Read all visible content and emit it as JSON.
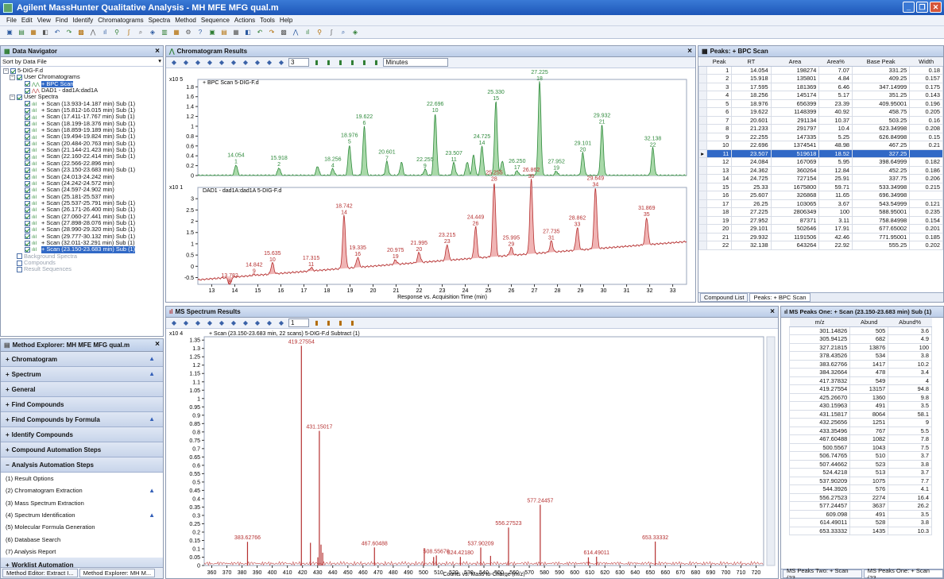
{
  "window": {
    "title": "Agilent MassHunter Qualitative Analysis - MH MFE MFG qual.m"
  },
  "menu": [
    "File",
    "Edit",
    "View",
    "Find",
    "Identify",
    "Chromatograms",
    "Spectra",
    "Method",
    "Sequence",
    "Actions",
    "Tools",
    "Help"
  ],
  "data_navigator": {
    "title": "Data Navigator",
    "sort_label": "Sort by Data File",
    "file": "5-DIG-F.d",
    "user_chromatograms": "User Chromatograms",
    "chrom_items": [
      "+ BPC Scan",
      "DAD1 - dad1A:dad1A"
    ],
    "user_spectra": "User Spectra",
    "spectra": [
      "+ Scan (13.933-14.187 min) Sub (1)",
      "+ Scan (15.812-16.015 min) Sub (1)",
      "+ Scan (17.411-17.767 min) Sub (1)",
      "+ Scan (18.199-18.376 min) Sub (1)",
      "+ Scan (18.859-19.189 min) Sub (1)",
      "+ Scan (19.494-19.824 min) Sub (1)",
      "+ Scan (20.484-20.763 min) Sub (1)",
      "+ Scan (21.144-21.423 min) Sub (1)",
      "+ Scan (22.160-22.414 min) Sub (1)",
      "+ Scan (22.566-22.896 min)",
      "+ Scan (23.150-23.683 min) Sub (1)",
      "+ Scan (24.013-24.242 min)",
      "+ Scan (24.242-24.572 min)",
      "+ Scan (24.597-24.902 min)",
      "+ Scan (25.181-25.537 min)",
      "+ Scan (25.537-25.791 min) Sub (1)",
      "+ Scan (26.171-26.400 min) Sub (1)",
      "+ Scan (27.060-27.441 min) Sub (1)",
      "+ Scan (27.898-28.076 min) Sub (1)",
      "+ Scan (28.990-29.320 min) Sub (1)",
      "+ Scan (29.777-30.132 min) Sub (1)",
      "+ Scan (32.011-32.291 min) Sub (1)",
      "+ Scan (23.150-23.683 min) Sub (1)"
    ],
    "other": [
      "Background Spectra",
      "Compounds",
      "Result Sequences"
    ]
  },
  "method_explorer": {
    "title": "Method Explorer: MH MFE MFG qual.m",
    "sections": [
      "Chromatogram",
      "Spectrum",
      "General",
      "Find Compounds",
      "Find Compounds by Formula",
      "Identify Compounds",
      "Compound Automation Steps",
      "Analysis Automation Steps"
    ],
    "steps": [
      "(1) Result Options",
      "(2) Chromatogram Extraction",
      "(3) Mass Spectrum Extraction",
      "(4) Spectrum Identification",
      "(5) Molecular Formula Generation",
      "(6) Database Search",
      "(7) Analysis Report"
    ],
    "worklist": "Worklist Automation",
    "bottom_tabs": [
      "Method Editor: Extract I...",
      "Method Explorer: MH M..."
    ]
  },
  "chromatogram": {
    "title": "Chromatogram Results",
    "toolbar_value": "3",
    "units": "Minutes",
    "bpc": {
      "label": "+ BPC Scan 5-DIG-F.d",
      "scale": "x10 5",
      "yticks": [
        "1.8",
        "1.6",
        "1.4",
        "1.2",
        "1",
        "0.8",
        "0.6",
        "0.4",
        "0.2",
        "0"
      ],
      "peaks": [
        {
          "rt": "14.054",
          "n": "1"
        },
        {
          "rt": "15.918",
          "n": "2"
        },
        {
          "rt": "18.256",
          "n": "4"
        },
        {
          "rt": "18.976",
          "n": "5"
        },
        {
          "rt": "19.622",
          "n": "6"
        },
        {
          "rt": "20.601",
          "n": "7"
        },
        {
          "rt": "22.255",
          "n": "9"
        },
        {
          "rt": "22.696",
          "n": "10"
        },
        {
          "rt": "23.507",
          "n": "11"
        },
        {
          "rt": "24.725",
          "n": "14"
        },
        {
          "rt": "25.330",
          "n": "15"
        },
        {
          "rt": "26.250",
          "n": "17"
        },
        {
          "rt": "27.225",
          "n": "18"
        },
        {
          "rt": "27.952",
          "n": "19"
        },
        {
          "rt": "29.101",
          "n": "20"
        },
        {
          "rt": "29.932",
          "n": "21"
        },
        {
          "rt": "32.138",
          "n": "22"
        }
      ]
    },
    "dad": {
      "label": "DAD1 - dad1A:dad1A 5-DIG-F.d",
      "scale": "x10 1",
      "yticks": [
        "3",
        "2.5",
        "2",
        "1.5",
        "1",
        "0.5",
        "0",
        "-0.5"
      ],
      "peaks": [
        {
          "rt": "13.782",
          "n": "8"
        },
        {
          "rt": "14.842",
          "n": "9"
        },
        {
          "rt": "15.635",
          "n": "10"
        },
        {
          "rt": "17.315",
          "n": "11"
        },
        {
          "rt": "18.742",
          "n": "14"
        },
        {
          "rt": "19.335",
          "n": "16"
        },
        {
          "rt": "20.975",
          "n": "19"
        },
        {
          "rt": "21.995",
          "n": "20"
        },
        {
          "rt": "23.215",
          "n": "23"
        },
        {
          "rt": "24.449",
          "n": "26"
        },
        {
          "rt": "25.255",
          "n": "28"
        },
        {
          "rt": "25.995",
          "n": "29"
        },
        {
          "rt": "26.862",
          "n": "30"
        },
        {
          "rt": "27.735",
          "n": "31"
        },
        {
          "rt": "28.862",
          "n": "33"
        },
        {
          "rt": "29.649",
          "n": "34"
        },
        {
          "rt": "31.869",
          "n": "35"
        }
      ]
    },
    "xticks": [
      "13",
      "14",
      "15",
      "16",
      "17",
      "18",
      "19",
      "20",
      "21",
      "22",
      "23",
      "24",
      "25",
      "26",
      "27",
      "28",
      "29",
      "30",
      "31",
      "32",
      "33"
    ],
    "xlabel": "Response vs. Acquisition Time (min)"
  },
  "peaks_table": {
    "title": "Peaks: + BPC Scan",
    "columns": [
      "Peak",
      "RT",
      "Area",
      "Area%",
      "Base Peak",
      "Width"
    ],
    "rows": [
      [
        "1",
        "14.054",
        "198274",
        "7.07",
        "331.25",
        "0.18"
      ],
      [
        "2",
        "15.918",
        "135801",
        "4.84",
        "409.25",
        "0.157"
      ],
      [
        "3",
        "17.595",
        "181369",
        "6.46",
        "347.14999",
        "0.175"
      ],
      [
        "4",
        "18.256",
        "145174",
        "5.17",
        "351.25",
        "0.143"
      ],
      [
        "5",
        "18.976",
        "656399",
        "23.39",
        "409.95001",
        "0.196"
      ],
      [
        "6",
        "19.622",
        "1148399",
        "40.92",
        "458.75",
        "0.205"
      ],
      [
        "7",
        "20.601",
        "291134",
        "10.37",
        "503.25",
        "0.16"
      ],
      [
        "8",
        "21.233",
        "291797",
        "10.4",
        "623.34998",
        "0.208"
      ],
      [
        "9",
        "22.255",
        "147335",
        "5.25",
        "626.84998",
        "0.15"
      ],
      [
        "10",
        "22.696",
        "1374541",
        "48.98",
        "467.25",
        "0.21"
      ],
      [
        "11",
        "23.507",
        "519618",
        "18.52",
        "327.25",
        ""
      ],
      [
        "12",
        "24.084",
        "167069",
        "5.95",
        "398.64999",
        "0.182"
      ],
      [
        "13",
        "24.362",
        "360264",
        "12.84",
        "452.25",
        "0.186"
      ],
      [
        "14",
        "24.725",
        "727154",
        "25.91",
        "337.75",
        "0.206"
      ],
      [
        "15",
        "25.33",
        "1675800",
        "59.71",
        "533.34998",
        "0.215"
      ],
      [
        "16",
        "25.607",
        "326868",
        "11.65",
        "696.34998",
        ""
      ],
      [
        "17",
        "26.25",
        "103065",
        "3.67",
        "543.54999",
        "0.121"
      ],
      [
        "18",
        "27.225",
        "2806349",
        "100",
        "588.95001",
        "0.235"
      ],
      [
        "19",
        "27.952",
        "87371",
        "3.11",
        "758.84998",
        "0.154"
      ],
      [
        "20",
        "29.101",
        "502646",
        "17.91",
        "677.65002",
        "0.201"
      ],
      [
        "21",
        "29.932",
        "1191506",
        "42.46",
        "771.95001",
        "0.185"
      ],
      [
        "22",
        "32.138",
        "643264",
        "22.92",
        "555.25",
        "0.202"
      ]
    ],
    "selected_row": 10,
    "tabs": [
      "Compound List",
      "Peaks: + BPC Scan"
    ]
  },
  "ms_spectrum": {
    "title": "MS Spectrum Results",
    "label": "+ Scan (23.150-23.683 min, 22 scans) 5-DIG-F.d  Subtract (1)",
    "scale": "x10 4",
    "yticks": [
      "1.35",
      "1.3",
      "1.25",
      "1.2",
      "1.15",
      "1.1",
      "1.05",
      "1",
      "0.95",
      "0.9",
      "0.85",
      "0.8",
      "0.75",
      "0.7",
      "0.65",
      "0.6",
      "0.55",
      "0.5",
      "0.45",
      "0.4",
      "0.35",
      "0.3",
      "0.25",
      "0.2",
      "0.15",
      "0.1",
      "0.05",
      "0"
    ],
    "xticks": [
      "360",
      "370",
      "380",
      "390",
      "400",
      "410",
      "420",
      "430",
      "440",
      "450",
      "460",
      "470",
      "480",
      "490",
      "500",
      "510",
      "520",
      "530",
      "540",
      "550",
      "560",
      "570",
      "580",
      "590",
      "600",
      "610",
      "620",
      "630",
      "640",
      "650",
      "660",
      "670",
      "680",
      "690",
      "700",
      "710",
      "720"
    ],
    "xlabel": "Counts vs. Mass-to-Charge (m/z)",
    "labels": [
      "419.27554",
      "431.15017",
      "383.62766",
      "467.60488",
      "508.55670",
      "524.42180",
      "537.90209",
      "556.27523",
      "577.24457",
      "614.49011",
      "653.33332"
    ]
  },
  "ms_peaks": {
    "title": "MS Peaks One: + Scan (23.150-23.683 min) Sub (1)",
    "columns": [
      "m/z",
      "Abund",
      "Abund%"
    ],
    "rows": [
      [
        "301.14826",
        "505",
        "3.6"
      ],
      [
        "305.94125",
        "682",
        "4.9"
      ],
      [
        "327.21815",
        "13876",
        "100"
      ],
      [
        "378.43526",
        "534",
        "3.8"
      ],
      [
        "383.62766",
        "1417",
        "10.2"
      ],
      [
        "384.32664",
        "478",
        "3.4"
      ],
      [
        "417.37832",
        "549",
        "4"
      ],
      [
        "419.27554",
        "13157",
        "94.8"
      ],
      [
        "425.26670",
        "1360",
        "9.8"
      ],
      [
        "430.15963",
        "491",
        "3.5"
      ],
      [
        "431.15817",
        "8064",
        "58.1"
      ],
      [
        "432.25656",
        "1251",
        "9"
      ],
      [
        "433.35496",
        "767",
        "5.5"
      ],
      [
        "467.60488",
        "1082",
        "7.8"
      ],
      [
        "500.5567",
        "1043",
        "7.5"
      ],
      [
        "506.74765",
        "510",
        "3.7"
      ],
      [
        "507.44662",
        "523",
        "3.8"
      ],
      [
        "524.4218",
        "513",
        "3.7"
      ],
      [
        "537.90209",
        "1075",
        "7.7"
      ],
      [
        "544.3926",
        "576",
        "4.1"
      ],
      [
        "556.27523",
        "2274",
        "16.4"
      ],
      [
        "577.24457",
        "3637",
        "26.2"
      ],
      [
        "609.098",
        "491",
        "3.5"
      ],
      [
        "614.49011",
        "528",
        "3.8"
      ],
      [
        "653.33332",
        "1435",
        "10.3"
      ]
    ],
    "tabs": [
      "MS Peaks Two: + Scan (23...",
      "MS Peaks One: + Scan (23..."
    ]
  },
  "chart_data": [
    {
      "type": "line",
      "title": "+ BPC Scan 5-DIG-F.d",
      "xlabel": "Response vs. Acquisition Time (min)",
      "xlim": [
        12.4,
        33.6
      ],
      "ylim": [
        0,
        1.95
      ],
      "series": [
        {
          "name": "+ BPC Scan",
          "peaks": [
            [
              14.054,
              0.22
            ],
            [
              15.918,
              0.16
            ],
            [
              17.595,
              0.19
            ],
            [
              18.256,
              0.14
            ],
            [
              18.976,
              0.62
            ],
            [
              19.622,
              1.0
            ],
            [
              20.601,
              0.28
            ],
            [
              21.233,
              0.27
            ],
            [
              22.255,
              0.13
            ],
            [
              22.696,
              1.26
            ],
            [
              23.507,
              0.26
            ],
            [
              24.084,
              0.28
            ],
            [
              24.362,
              0.42
            ],
            [
              24.725,
              0.6
            ],
            [
              25.33,
              1.5
            ],
            [
              25.607,
              0.3
            ],
            [
              26.25,
              0.1
            ],
            [
              27.225,
              1.9
            ],
            [
              27.952,
              0.09
            ],
            [
              29.101,
              0.46
            ],
            [
              29.932,
              1.02
            ],
            [
              32.138,
              0.56
            ]
          ]
        }
      ]
    },
    {
      "type": "line",
      "title": "DAD1 - dad1A:dad1A 5-DIG-F.d",
      "xlim": [
        12.4,
        33.6
      ],
      "ylim": [
        -0.8,
        3.5
      ],
      "series": [
        {
          "name": "DAD1 - dad1A:dad1A",
          "peaks": [
            [
              13.782,
              -0.35
            ],
            [
              14.842,
              0.05
            ],
            [
              15.635,
              0.5
            ],
            [
              17.315,
              0.15
            ],
            [
              18.742,
              2.35
            ],
            [
              19.335,
              0.45
            ],
            [
              20.975,
              0.2
            ],
            [
              21.995,
              0.45
            ],
            [
              23.215,
              0.7
            ],
            [
              24.449,
              1.4
            ],
            [
              25.255,
              3.3
            ],
            [
              25.995,
              0.35
            ],
            [
              26.862,
              3.3
            ],
            [
              27.735,
              0.5
            ],
            [
              28.862,
              1.0
            ],
            [
              29.649,
              2.7
            ],
            [
              31.869,
              1.2
            ]
          ]
        }
      ]
    },
    {
      "type": "bar",
      "title": "+ Scan (23.150-23.683 min, 22 scans) 5-DIG-F.d  Subtract (1)",
      "xlabel": "Counts vs. Mass-to-Charge (m/z)",
      "xlim": [
        355,
        725
      ],
      "ylim": [
        0,
        1.37
      ],
      "x": [
        383.62766,
        419.27554,
        425.2667,
        430.15963,
        431.15017,
        432.25656,
        433.35496,
        467.60488,
        500.5567,
        506.74765,
        508.5567,
        524.4218,
        537.90209,
        544.3926,
        556.27523,
        577.24457,
        609.098,
        614.49011,
        653.33332
      ],
      "values": [
        0.1417,
        1.3157,
        0.136,
        0.0491,
        0.8064,
        0.1251,
        0.0767,
        0.1082,
        0.1043,
        0.051,
        0.06,
        0.0513,
        0.1075,
        0.0576,
        0.2274,
        0.3637,
        0.0491,
        0.0528,
        0.1435
      ]
    }
  ]
}
